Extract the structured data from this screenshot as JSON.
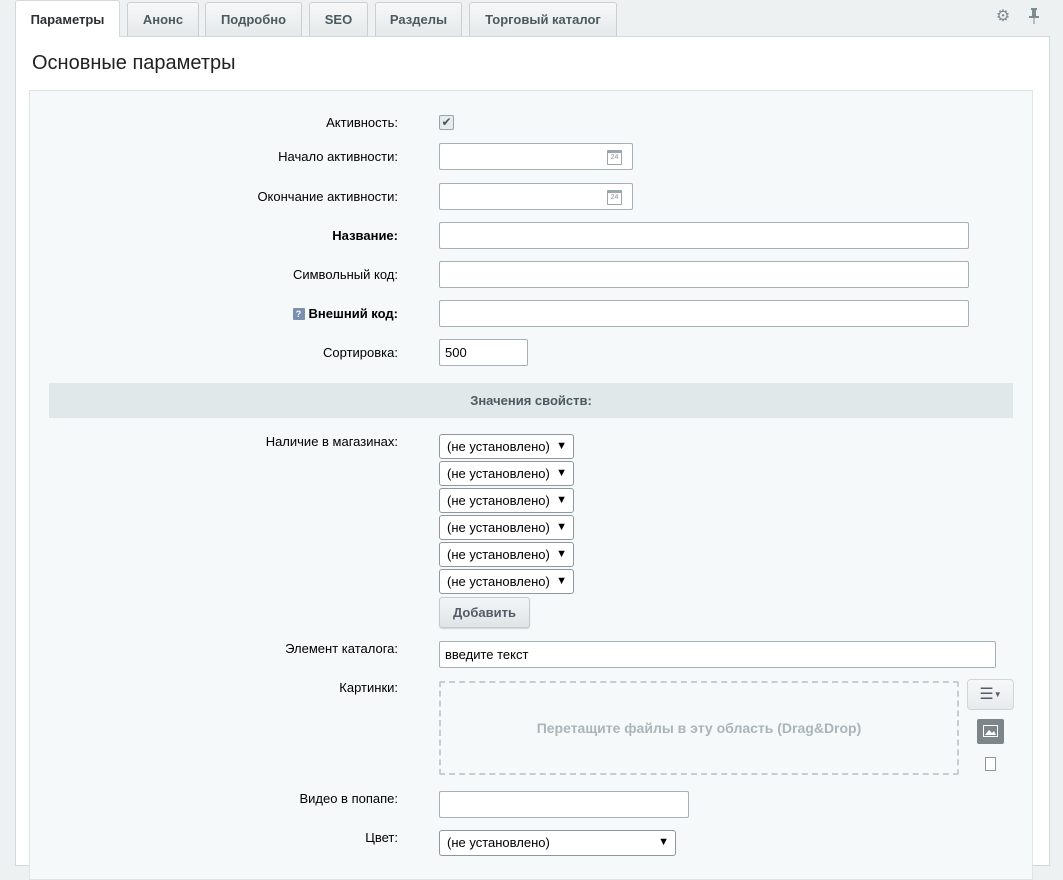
{
  "tabs": [
    {
      "label": "Параметры",
      "active": true
    },
    {
      "label": "Анонс"
    },
    {
      "label": "Подробно"
    },
    {
      "label": "SEO"
    },
    {
      "label": "Разделы"
    },
    {
      "label": "Торговый каталог"
    }
  ],
  "icons": {
    "settings": "⚙",
    "pin": "📌"
  },
  "section_title": "Основные параметры",
  "fields": {
    "active_label": "Активность:",
    "active_checked": true,
    "active_from_label": "Начало активности:",
    "active_from_value": "",
    "active_to_label": "Окончание активности:",
    "active_to_value": "",
    "calendar_icon_text": "24",
    "name_label": "Название:",
    "name_value": "",
    "code_label": "Символьный код:",
    "code_value": "",
    "xml_id_label": "Внешний код:",
    "xml_id_value": "",
    "help_icon_text": "?",
    "sort_label": "Сортировка:",
    "sort_value": "500"
  },
  "properties": {
    "header": "Значения свойств:",
    "stores_label": "Наличие в магазинах:",
    "store_selects": [
      "(не установлено)",
      "(не установлено)",
      "(не установлено)",
      "(не установлено)",
      "(не установлено)",
      "(не установлено)"
    ],
    "add_button": "Добавить",
    "catalog_item_label": "Элемент каталога:",
    "catalog_item_value": "введите текст",
    "pictures_label": "Картинки:",
    "dropzone_text": "Перетащите файлы в эту область (Drag&Drop)",
    "video_label": "Видео в попапе:",
    "video_value": "",
    "color_label": "Цвет:",
    "color_value": "(не установлено)"
  }
}
